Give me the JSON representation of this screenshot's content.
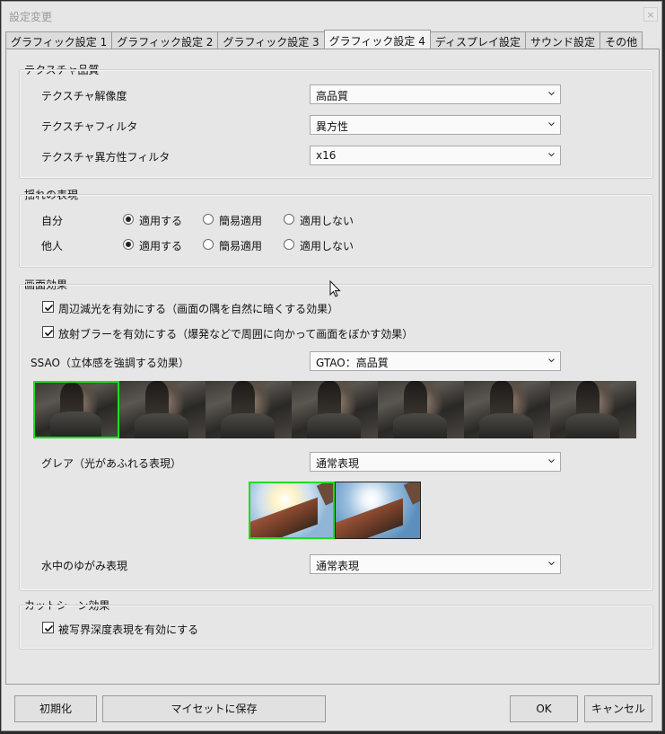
{
  "window": {
    "title": "設定変更",
    "close_glyph": "×"
  },
  "tabs": [
    {
      "label": "グラフィック設定 1",
      "active": false
    },
    {
      "label": "グラフィック設定 2",
      "active": false
    },
    {
      "label": "グラフィック設定 3",
      "active": false
    },
    {
      "label": "グラフィック設定 4",
      "active": true
    },
    {
      "label": "ディスプレイ設定",
      "active": false
    },
    {
      "label": "サウンド設定",
      "active": false
    },
    {
      "label": "その他",
      "active": false
    }
  ],
  "texture": {
    "group_title": "テクスチャ品質",
    "rows": [
      {
        "label": "テクスチャ解像度",
        "value": "高品質"
      },
      {
        "label": "テクスチャフィルタ",
        "value": "異方性"
      },
      {
        "label": "テクスチャ異方性フィルタ",
        "value": "x16"
      }
    ]
  },
  "sway": {
    "group_title": "揺れの表現",
    "options": [
      "適用する",
      "簡易適用",
      "適用しない"
    ],
    "rows": [
      {
        "label": "自分",
        "selected": "適用する"
      },
      {
        "label": "他人",
        "selected": "適用する"
      }
    ]
  },
  "screen_effects": {
    "group_title": "画面効果",
    "vignette": {
      "label": "周辺減光を有効にする（画面の隅を自然に暗くする効果）",
      "checked": true
    },
    "radial_blur": {
      "label": "放射ブラーを有効にする（爆発などで周囲に向かって画面をぼかす効果）",
      "checked": true
    },
    "ssao": {
      "label": "SSAO（立体感を強調する効果）",
      "value": "GTAO：高品質",
      "selected_preview": 1,
      "preview_count": 7
    },
    "glare": {
      "label": "グレア（光があふれる表現）",
      "value": "通常表現",
      "selected_preview": 1,
      "preview_count": 2
    },
    "underwater": {
      "label": "水中のゆがみ表現",
      "value": "通常表現"
    }
  },
  "cutscene": {
    "group_title": "カットシーン効果",
    "dof": {
      "label": "被写界深度表現を有効にする",
      "checked": true
    }
  },
  "footer": {
    "reset": "初期化",
    "save_preset": "マイセットに保存",
    "ok": "OK",
    "cancel": "キャンセル"
  }
}
